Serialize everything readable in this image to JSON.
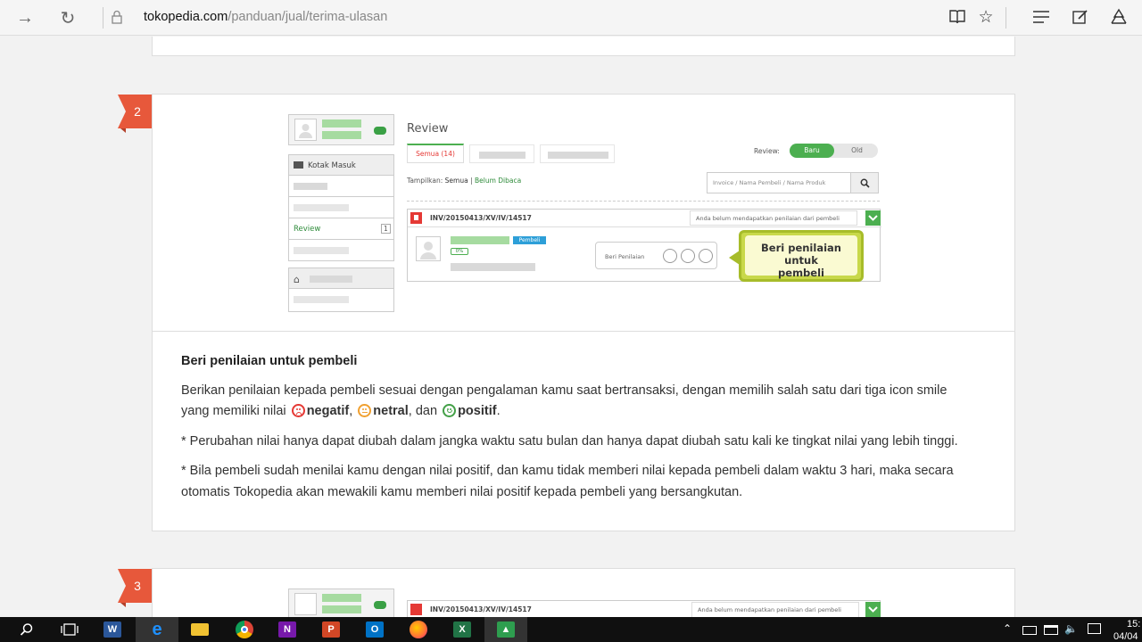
{
  "browser": {
    "address_domain": "tokopedia.com",
    "address_path": "/panduan/jual/terima-ulasan",
    "icons": [
      "back-icon",
      "refresh-icon",
      "lock-icon",
      "reading-view-icon",
      "star-icon",
      "hub-icon",
      "web-note-icon",
      "share-icon"
    ]
  },
  "steps": [
    {
      "number": "2"
    },
    {
      "number": "3"
    }
  ],
  "screenshot": {
    "sidebar_inbox": "Kotak Masuk",
    "sidebar_review": "Review",
    "sidebar_review_count": "1",
    "title": "Review",
    "tab_all": "Semua (14)",
    "review_filter_label": "Review:",
    "toggle_new": "Baru",
    "toggle_old": "Old",
    "show_label": "Tampilkan:",
    "show_all": "Semua",
    "show_unread": "Belum Dibaca",
    "search_placeholder": "Invoice / Nama Pembeli / Nama Produk",
    "invoice": "INV/20150413/XV/IV/14517",
    "status_text": "Anda belum mendapatkan penilaian dari pembeli",
    "buyer_badge": "Pembeli",
    "buyer_percent": "0%",
    "rating_label": "Beri Penilaian",
    "callout": "Beri penilaian untuk pembeli"
  },
  "content": {
    "heading": "Beri penilaian untuk pembeli",
    "para1_a": "Berikan penilaian kepada pembeli sesuai dengan pengalaman kamu saat bertransaksi, dengan memilih salah satu dari tiga icon smile",
    "para1_b": "yang memiliki nilai",
    "negatif": "negatif",
    "comma": ",",
    "netral": "netral",
    "dan": ", dan",
    "positif": "positif",
    "period": ".",
    "note1": "* Perubahan nilai hanya dapat diubah dalam jangka waktu satu bulan dan hanya dapat diubah satu kali ke tingkat nilai yang lebih tinggi.",
    "note2_a": "* Bila pembeli sudah menilai kamu dengan nilai positif, dan kamu tidak memberi nilai kepada pembeli dalam waktu 3 hari, maka secara",
    "note2_b": "otomatis Tokopedia akan mewakili kamu memberi nilai positif kepada pembeli yang bersangkutan."
  },
  "colors": {
    "accent_green": "#4caf50",
    "step_orange": "#e7583b",
    "negative": "#e53935",
    "neutral": "#f0a030",
    "positive": "#43a047"
  },
  "taskbar": {
    "time": "15:",
    "date": "04/04",
    "apps": [
      "search-icon",
      "task-view-icon",
      "word-icon",
      "edge-icon",
      "file-explorer-icon",
      "chrome-icon",
      "onenote-icon",
      "powerpoint-icon",
      "outlook-icon",
      "firefox-icon",
      "excel-icon",
      "app-icon"
    ]
  }
}
